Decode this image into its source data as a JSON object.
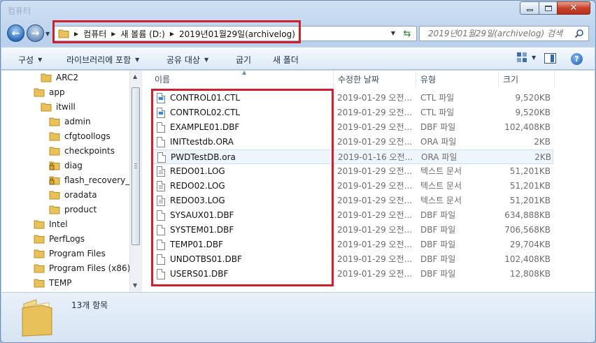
{
  "window": {
    "title": "컴퓨터"
  },
  "address": {
    "crumbs": [
      "컴퓨터",
      "새 볼륨 (D:)",
      "2019년01월29일(archivelog)"
    ]
  },
  "search": {
    "placeholder": "2019년01월29일(archivelog) 검색"
  },
  "toolbar": {
    "organize": "구성",
    "library": "라이브러리에 포함",
    "share": "공유 대상",
    "burn": "굽기",
    "new_folder": "새 폴더"
  },
  "tree": [
    {
      "label": "ARC2",
      "level": 2,
      "locked": false
    },
    {
      "label": "app",
      "level": 1,
      "locked": false
    },
    {
      "label": "itwill",
      "level": 2,
      "locked": false
    },
    {
      "label": "admin",
      "level": 3,
      "locked": false
    },
    {
      "label": "cfgtoollogs",
      "level": 3,
      "locked": false
    },
    {
      "label": "checkpoints",
      "level": 3,
      "locked": false
    },
    {
      "label": "diag",
      "level": 3,
      "locked": true
    },
    {
      "label": "flash_recovery_are",
      "level": 3,
      "locked": true
    },
    {
      "label": "oradata",
      "level": 3,
      "locked": false
    },
    {
      "label": "product",
      "level": 3,
      "locked": false
    },
    {
      "label": "Intel",
      "level": 1,
      "locked": false
    },
    {
      "label": "PerfLogs",
      "level": 1,
      "locked": false
    },
    {
      "label": "Program Files",
      "level": 1,
      "locked": false
    },
    {
      "label": "Program Files (x86)",
      "level": 1,
      "locked": false
    },
    {
      "label": "TEMP",
      "level": 1,
      "locked": false
    }
  ],
  "columns": {
    "name": "이름",
    "date": "수정한 날짜",
    "type": "유형",
    "size": "크기"
  },
  "files": [
    {
      "name": "CONTROL01.CTL",
      "date": "2019-01-29 오전...",
      "type": "CTL 파일",
      "size": "9,520KB",
      "icon": "cfg"
    },
    {
      "name": "CONTROL02.CTL",
      "date": "2019-01-29 오전...",
      "type": "CTL 파일",
      "size": "9,520KB",
      "icon": "cfg"
    },
    {
      "name": "EXAMPLE01.DBF",
      "date": "2019-01-29 오전...",
      "type": "DBF 파일",
      "size": "102,408KB",
      "icon": "plain"
    },
    {
      "name": "INITtestdb.ORA",
      "date": "2019-01-29 오전...",
      "type": "ORA 파일",
      "size": "2KB",
      "icon": "plain"
    },
    {
      "name": "PWDTestDB.ora",
      "date": "2019-01-16 오전...",
      "type": "ORA 파일",
      "size": "2KB",
      "icon": "plain"
    },
    {
      "name": "REDO01.LOG",
      "date": "2019-01-29 오전...",
      "type": "텍스트 문서",
      "size": "51,201KB",
      "icon": "txt"
    },
    {
      "name": "REDO02.LOG",
      "date": "2019-01-29 오전...",
      "type": "텍스트 문서",
      "size": "51,201KB",
      "icon": "txt"
    },
    {
      "name": "REDO03.LOG",
      "date": "2019-01-29 오전...",
      "type": "텍스트 문서",
      "size": "51,201KB",
      "icon": "txt"
    },
    {
      "name": "SYSAUX01.DBF",
      "date": "2019-01-29 오전...",
      "type": "DBF 파일",
      "size": "634,888KB",
      "icon": "plain"
    },
    {
      "name": "SYSTEM01.DBF",
      "date": "2019-01-29 오전...",
      "type": "DBF 파일",
      "size": "706,568KB",
      "icon": "plain"
    },
    {
      "name": "TEMP01.DBF",
      "date": "2019-01-29 오전...",
      "type": "DBF 파일",
      "size": "29,704KB",
      "icon": "plain"
    },
    {
      "name": "UNDOTBS01.DBF",
      "date": "2019-01-29 오전...",
      "type": "DBF 파일",
      "size": "102,408KB",
      "icon": "plain"
    },
    {
      "name": "USERS01.DBF",
      "date": "2019-01-29 오전...",
      "type": "DBF 파일",
      "size": "12,808KB",
      "icon": "plain"
    }
  ],
  "hovered_row": "PWDTestDB.ora",
  "status": {
    "count": "13개 항목"
  },
  "colors": {
    "highlight": "#d0202e",
    "folder": "#e8c15a",
    "hover_row": "#eef5fd"
  }
}
